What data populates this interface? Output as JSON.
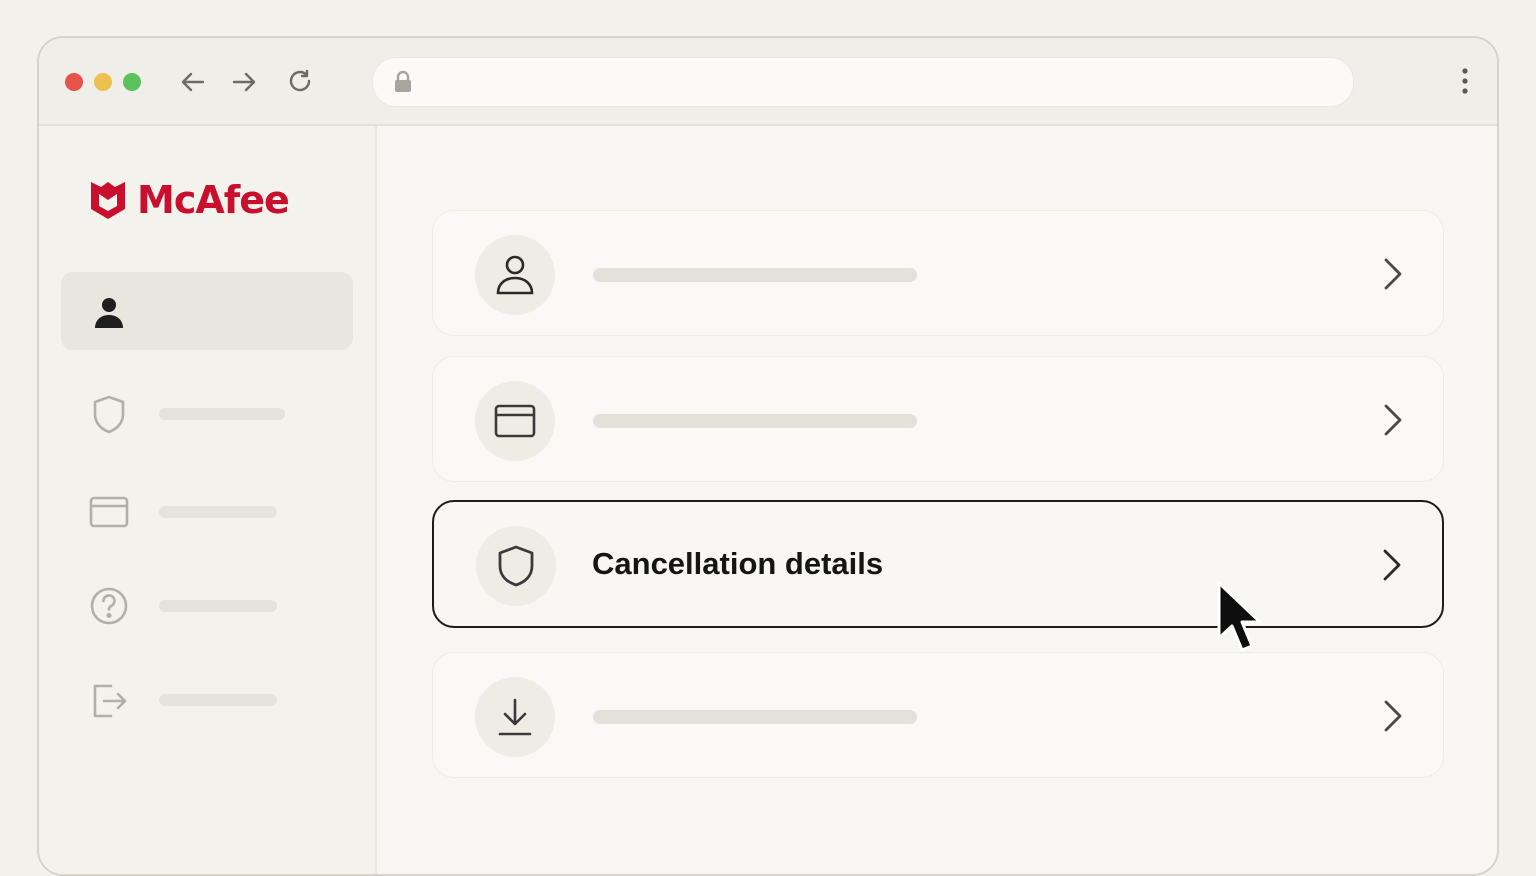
{
  "browser": {
    "traffic_lights": [
      "#e5534b",
      "#eec04f",
      "#5cc25b"
    ],
    "nav_icons": [
      "back-arrow-icon",
      "forward-arrow-icon",
      "reload-icon"
    ],
    "url_icon": "lock-icon",
    "menu_icon": "kebab-menu-icon"
  },
  "sidebar": {
    "logo_text": "McAfee",
    "brand_color": "#c8102e",
    "items": [
      {
        "icon": "person-icon",
        "active": true
      },
      {
        "icon": "shield-icon"
      },
      {
        "icon": "card-icon"
      },
      {
        "icon": "help-icon"
      },
      {
        "icon": "sign-out-icon"
      }
    ]
  },
  "main": {
    "cards": [
      {
        "icon": "person-outline-icon"
      },
      {
        "icon": "card-icon"
      },
      {
        "icon": "shield-icon",
        "label": "Cancellation details",
        "highlighted": true
      },
      {
        "icon": "download-icon"
      }
    ]
  }
}
